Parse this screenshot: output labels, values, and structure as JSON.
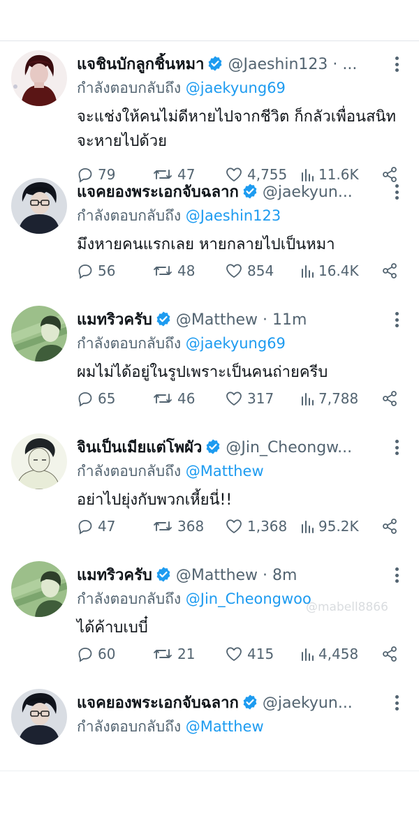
{
  "tweets": [
    {
      "name": "แจชินบักลูกชิ้นหมา",
      "handle": "@Jaeshin123 · ...",
      "reply_prefix": "กำลังตอบกลับถึง",
      "reply_to": "@jaekyung69",
      "text": "จะแช่งให้คนไม่ดีหายไปจากชีวิต ก็กลัวเพื่อนสนิทจะหายไปด้วย",
      "replies": "79",
      "retweets": "47",
      "likes": "4,755",
      "views": "11.6K"
    },
    {
      "name": "แจคยองพระเอกจับฉลาก",
      "handle": "@jaekyun...",
      "reply_prefix": "กำลังตอบกลับถึง",
      "reply_to": "@Jaeshin123",
      "text": "มึงหายคนแรกเลย หายกลายไปเป็นหมา",
      "replies": "56",
      "retweets": "48",
      "likes": "854",
      "views": "16.4K"
    },
    {
      "name": "แมทริวครับ",
      "handle": "@Matthew · 11m",
      "reply_prefix": "กำลังตอบกลับถึง",
      "reply_to": "@jaekyung69",
      "text": "ผมไม่ได้อยู่ในรูปเพราะเป็นคนถ่ายครีบ",
      "replies": "65",
      "retweets": "46",
      "likes": "317",
      "views": "7,788"
    },
    {
      "name": "จินเป็นเมียแต่โพผัว",
      "handle": "@Jin_Cheongw...",
      "reply_prefix": "กำลังตอบกลับถึง",
      "reply_to": "@Matthew",
      "text": "อย่าไปยุ่งกับพวกเหี้ยนี่!!",
      "replies": "47",
      "retweets": "368",
      "likes": "1,368",
      "views": "95.2K"
    },
    {
      "name": "แมทริวครับ",
      "handle": "@Matthew · 8m",
      "reply_prefix": "กำลังตอบกลับถึง",
      "reply_to": "@Jin_Cheongwoo",
      "text": "ได้ค้าบเบบี๋",
      "replies": "60",
      "retweets": "21",
      "likes": "415",
      "views": "4,458"
    },
    {
      "name": "แจคยองพระเอกจับฉลาก",
      "handle": "@jaekyun...",
      "reply_prefix": "กำลังตอบกลับถึง",
      "reply_to": "@Matthew",
      "text": "",
      "replies": "",
      "retweets": "",
      "likes": "",
      "views": ""
    }
  ],
  "watermark": "@mabell8866",
  "colors": {
    "accent": "#1d9bf0",
    "muted": "#536471",
    "text": "#0f1419"
  },
  "icons": [
    "verified-badge-icon",
    "more-options-icon",
    "reply-icon",
    "retweet-icon",
    "like-icon",
    "views-icon",
    "share-icon"
  ]
}
